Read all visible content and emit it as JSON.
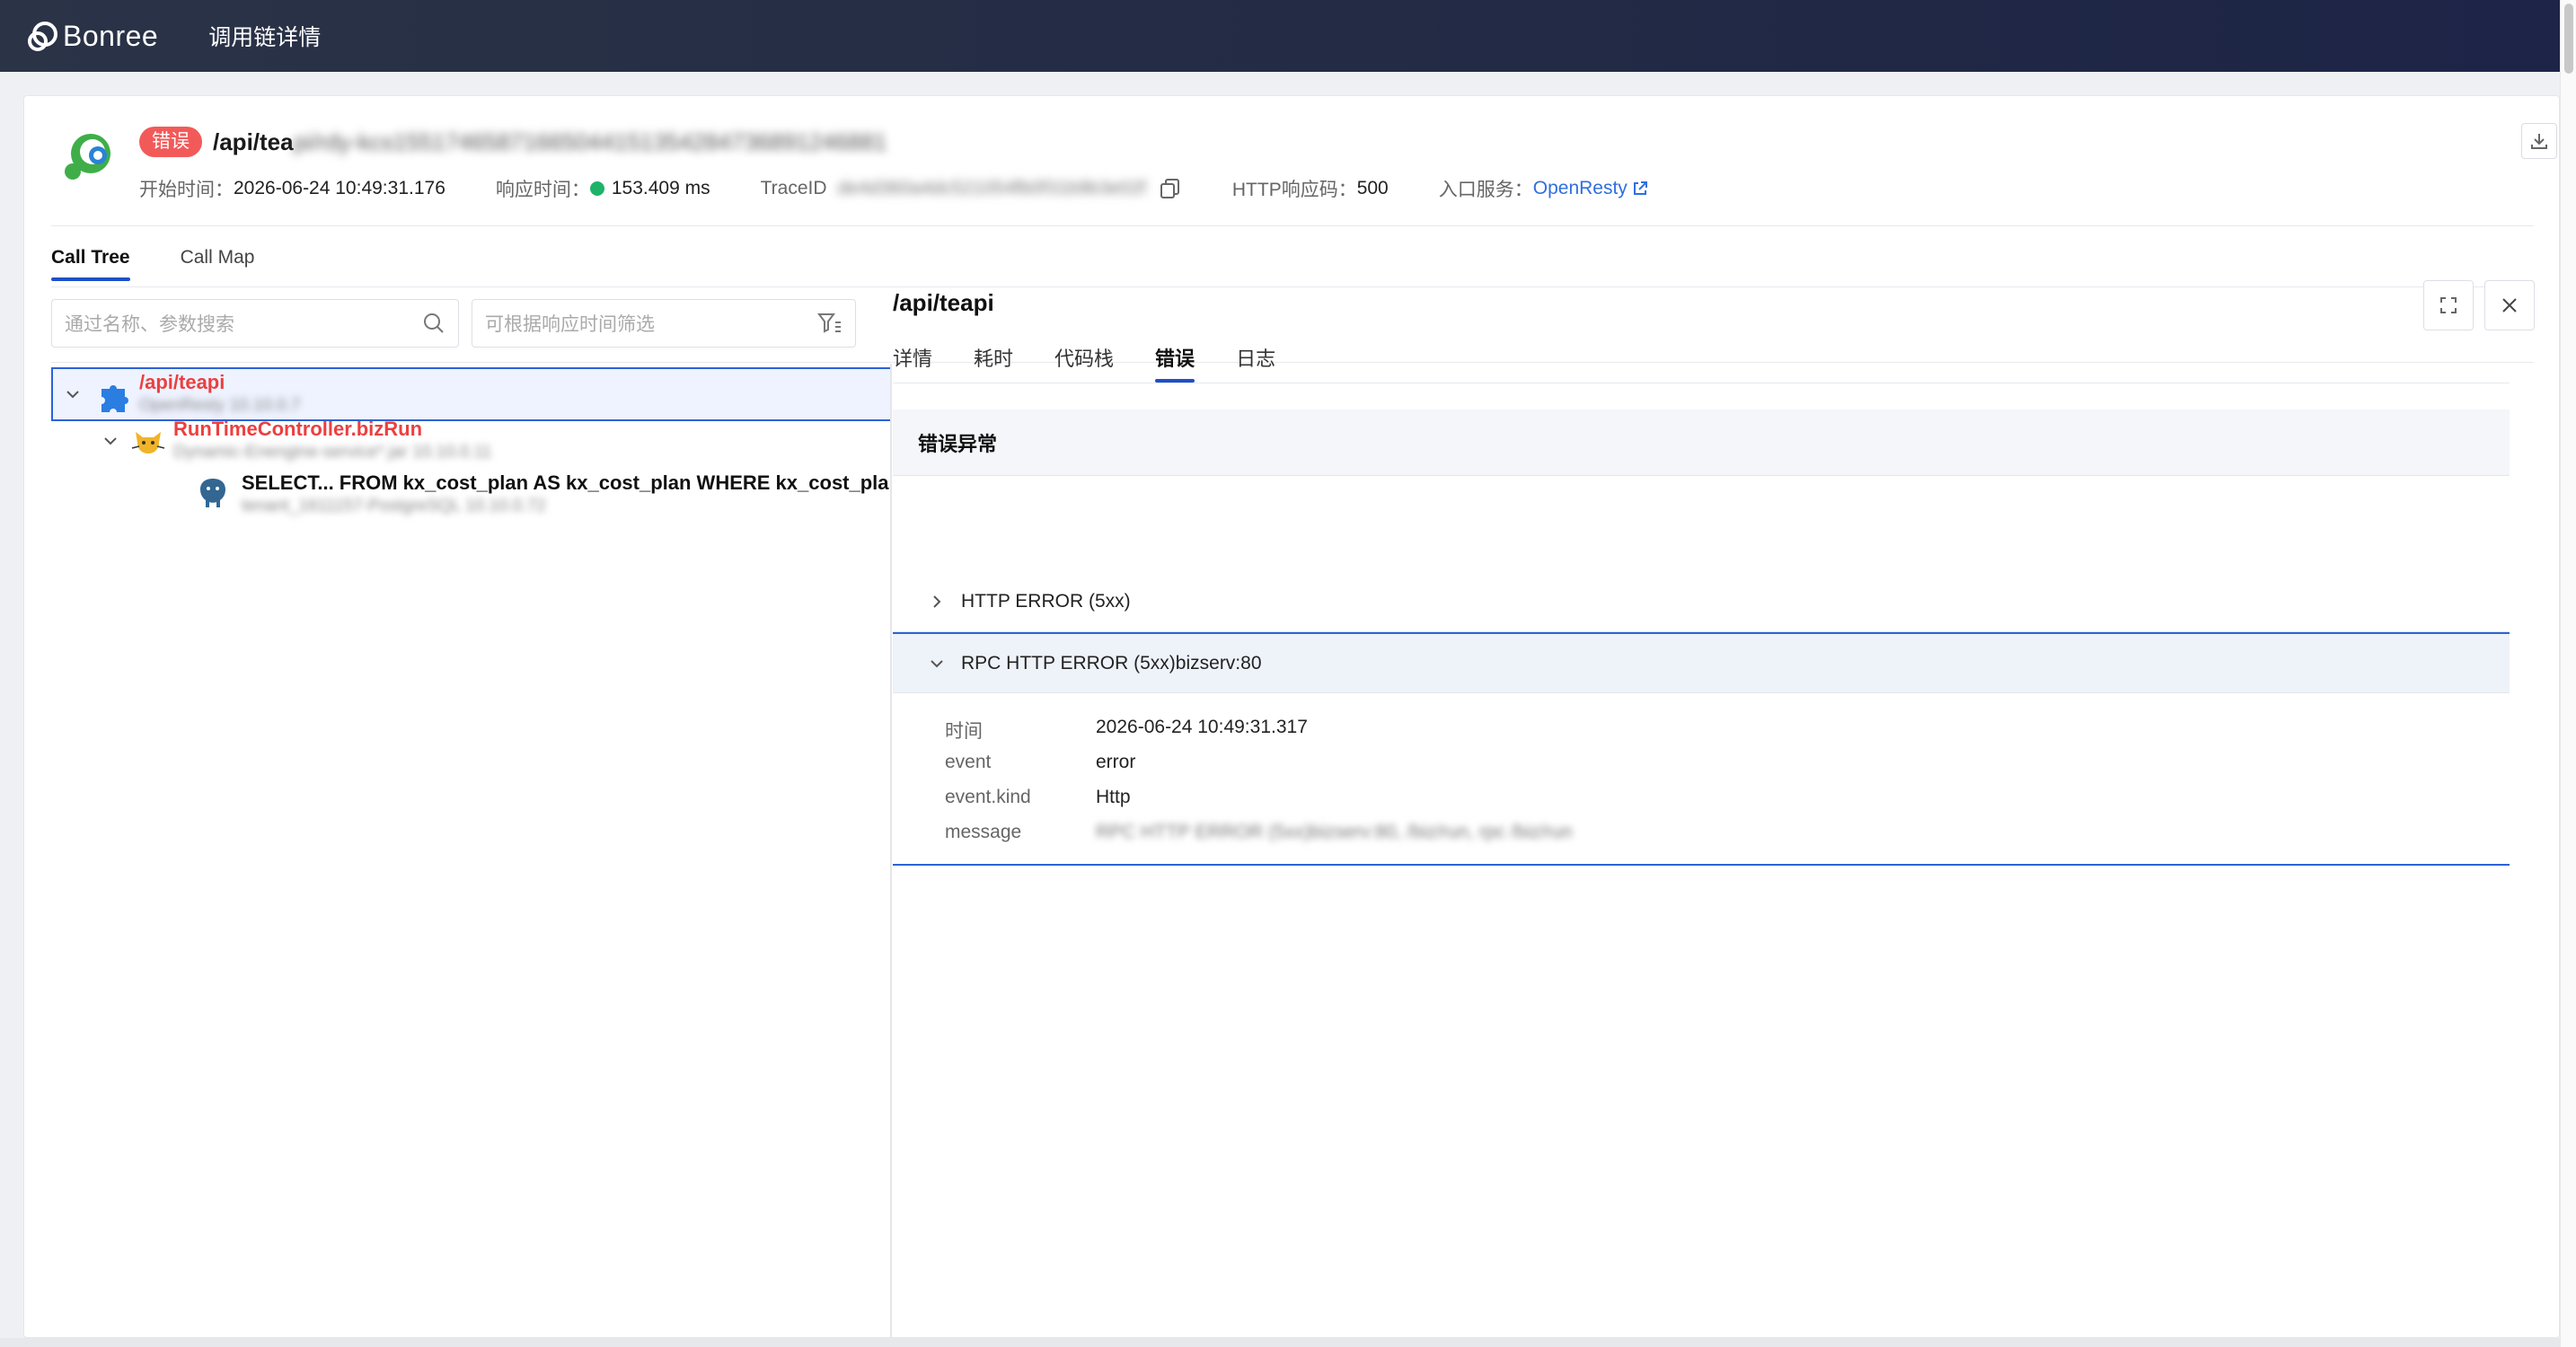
{
  "topbar": {
    "brand": "Bonree",
    "page_name": "调用链详情"
  },
  "header": {
    "status_badge": "错误",
    "title_prefix": "/api/tea",
    "title_rest_blurred": "pi/rdy-kcs15517465871665044151354284736891246881",
    "start_time_label": "开始时间：",
    "start_time": "2026-06-24 10:49:31.176",
    "response_time_label": "响应时间：",
    "response_time": "153.409 ms",
    "trace_id_label": "TraceID",
    "trace_id_blurred": "de4d360a4dc521054fb0f31b9b3e02f",
    "http_code_label": "HTTP响应码：",
    "http_code": "500",
    "entry_service_label": "入口服务：",
    "entry_service": "OpenResty"
  },
  "tabs": [
    {
      "label": "Call Tree",
      "active": true
    },
    {
      "label": "Call Map",
      "active": false
    }
  ],
  "filters": {
    "search_placeholder": "通过名称、参数搜索",
    "time_filter_placeholder": "可根据响应时间筛选"
  },
  "tree": [
    {
      "name": "/api/teapi",
      "sub": "OpenResty    10.10.0.7",
      "status": "error",
      "icon": "puzzle-icon"
    },
    {
      "name": "RunTimeController.bizRun",
      "sub": "Dynamic-Enengine-service*.jar    10.10.0.11",
      "status": "error",
      "icon": "tomcat-icon"
    },
    {
      "name": "SELECT... FROM kx_cost_plan AS kx_cost_plan WHERE kx_cost_plan",
      "sub": "tenant_1611157-PostgreSQL 10.10.0.72",
      "status": "normal",
      "icon": "postgresql-icon"
    }
  ],
  "detail": {
    "title": "/api/teapi",
    "tabs": [
      {
        "label": "详情",
        "active": false
      },
      {
        "label": "耗时",
        "active": false
      },
      {
        "label": "代码栈",
        "active": false
      },
      {
        "label": "错误",
        "active": true
      },
      {
        "label": "日志",
        "active": false
      }
    ],
    "section_title": "错误异常",
    "errors": [
      {
        "label": "HTTP ERROR (5xx)",
        "expanded": false
      },
      {
        "label": "RPC HTTP ERROR (5xx)bizserv:80",
        "expanded": true
      }
    ],
    "fields": [
      {
        "key": "时间",
        "value": "2026-06-24 10:49:31.317"
      },
      {
        "key": "event",
        "value": "error"
      },
      {
        "key": "event.kind",
        "value": "Http"
      },
      {
        "key": "message",
        "value": "RPC HTTP ERROR (5xx)bizserv:80, /biz/run, rpc /biz/run"
      }
    ]
  },
  "colors": {
    "accent": "#1e50c8",
    "error": "#ec3f3f",
    "badge": "#f25a5a",
    "success_dot": "#1fb36a",
    "link": "#2f6fe0"
  }
}
